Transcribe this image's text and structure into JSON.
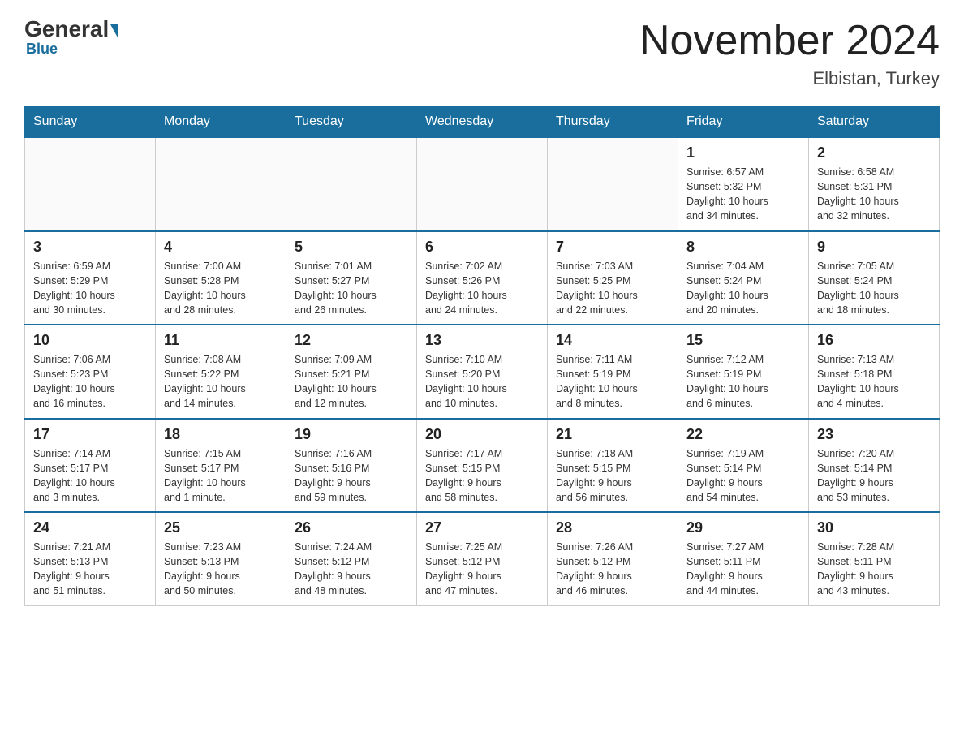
{
  "header": {
    "logo_general": "General",
    "logo_blue": "Blue",
    "main_title": "November 2024",
    "subtitle": "Elbistan, Turkey"
  },
  "weekdays": [
    "Sunday",
    "Monday",
    "Tuesday",
    "Wednesday",
    "Thursday",
    "Friday",
    "Saturday"
  ],
  "weeks": [
    [
      {
        "day": "",
        "info": ""
      },
      {
        "day": "",
        "info": ""
      },
      {
        "day": "",
        "info": ""
      },
      {
        "day": "",
        "info": ""
      },
      {
        "day": "",
        "info": ""
      },
      {
        "day": "1",
        "info": "Sunrise: 6:57 AM\nSunset: 5:32 PM\nDaylight: 10 hours\nand 34 minutes."
      },
      {
        "day": "2",
        "info": "Sunrise: 6:58 AM\nSunset: 5:31 PM\nDaylight: 10 hours\nand 32 minutes."
      }
    ],
    [
      {
        "day": "3",
        "info": "Sunrise: 6:59 AM\nSunset: 5:29 PM\nDaylight: 10 hours\nand 30 minutes."
      },
      {
        "day": "4",
        "info": "Sunrise: 7:00 AM\nSunset: 5:28 PM\nDaylight: 10 hours\nand 28 minutes."
      },
      {
        "day": "5",
        "info": "Sunrise: 7:01 AM\nSunset: 5:27 PM\nDaylight: 10 hours\nand 26 minutes."
      },
      {
        "day": "6",
        "info": "Sunrise: 7:02 AM\nSunset: 5:26 PM\nDaylight: 10 hours\nand 24 minutes."
      },
      {
        "day": "7",
        "info": "Sunrise: 7:03 AM\nSunset: 5:25 PM\nDaylight: 10 hours\nand 22 minutes."
      },
      {
        "day": "8",
        "info": "Sunrise: 7:04 AM\nSunset: 5:24 PM\nDaylight: 10 hours\nand 20 minutes."
      },
      {
        "day": "9",
        "info": "Sunrise: 7:05 AM\nSunset: 5:24 PM\nDaylight: 10 hours\nand 18 minutes."
      }
    ],
    [
      {
        "day": "10",
        "info": "Sunrise: 7:06 AM\nSunset: 5:23 PM\nDaylight: 10 hours\nand 16 minutes."
      },
      {
        "day": "11",
        "info": "Sunrise: 7:08 AM\nSunset: 5:22 PM\nDaylight: 10 hours\nand 14 minutes."
      },
      {
        "day": "12",
        "info": "Sunrise: 7:09 AM\nSunset: 5:21 PM\nDaylight: 10 hours\nand 12 minutes."
      },
      {
        "day": "13",
        "info": "Sunrise: 7:10 AM\nSunset: 5:20 PM\nDaylight: 10 hours\nand 10 minutes."
      },
      {
        "day": "14",
        "info": "Sunrise: 7:11 AM\nSunset: 5:19 PM\nDaylight: 10 hours\nand 8 minutes."
      },
      {
        "day": "15",
        "info": "Sunrise: 7:12 AM\nSunset: 5:19 PM\nDaylight: 10 hours\nand 6 minutes."
      },
      {
        "day": "16",
        "info": "Sunrise: 7:13 AM\nSunset: 5:18 PM\nDaylight: 10 hours\nand 4 minutes."
      }
    ],
    [
      {
        "day": "17",
        "info": "Sunrise: 7:14 AM\nSunset: 5:17 PM\nDaylight: 10 hours\nand 3 minutes."
      },
      {
        "day": "18",
        "info": "Sunrise: 7:15 AM\nSunset: 5:17 PM\nDaylight: 10 hours\nand 1 minute."
      },
      {
        "day": "19",
        "info": "Sunrise: 7:16 AM\nSunset: 5:16 PM\nDaylight: 9 hours\nand 59 minutes."
      },
      {
        "day": "20",
        "info": "Sunrise: 7:17 AM\nSunset: 5:15 PM\nDaylight: 9 hours\nand 58 minutes."
      },
      {
        "day": "21",
        "info": "Sunrise: 7:18 AM\nSunset: 5:15 PM\nDaylight: 9 hours\nand 56 minutes."
      },
      {
        "day": "22",
        "info": "Sunrise: 7:19 AM\nSunset: 5:14 PM\nDaylight: 9 hours\nand 54 minutes."
      },
      {
        "day": "23",
        "info": "Sunrise: 7:20 AM\nSunset: 5:14 PM\nDaylight: 9 hours\nand 53 minutes."
      }
    ],
    [
      {
        "day": "24",
        "info": "Sunrise: 7:21 AM\nSunset: 5:13 PM\nDaylight: 9 hours\nand 51 minutes."
      },
      {
        "day": "25",
        "info": "Sunrise: 7:23 AM\nSunset: 5:13 PM\nDaylight: 9 hours\nand 50 minutes."
      },
      {
        "day": "26",
        "info": "Sunrise: 7:24 AM\nSunset: 5:12 PM\nDaylight: 9 hours\nand 48 minutes."
      },
      {
        "day": "27",
        "info": "Sunrise: 7:25 AM\nSunset: 5:12 PM\nDaylight: 9 hours\nand 47 minutes."
      },
      {
        "day": "28",
        "info": "Sunrise: 7:26 AM\nSunset: 5:12 PM\nDaylight: 9 hours\nand 46 minutes."
      },
      {
        "day": "29",
        "info": "Sunrise: 7:27 AM\nSunset: 5:11 PM\nDaylight: 9 hours\nand 44 minutes."
      },
      {
        "day": "30",
        "info": "Sunrise: 7:28 AM\nSunset: 5:11 PM\nDaylight: 9 hours\nand 43 minutes."
      }
    ]
  ]
}
